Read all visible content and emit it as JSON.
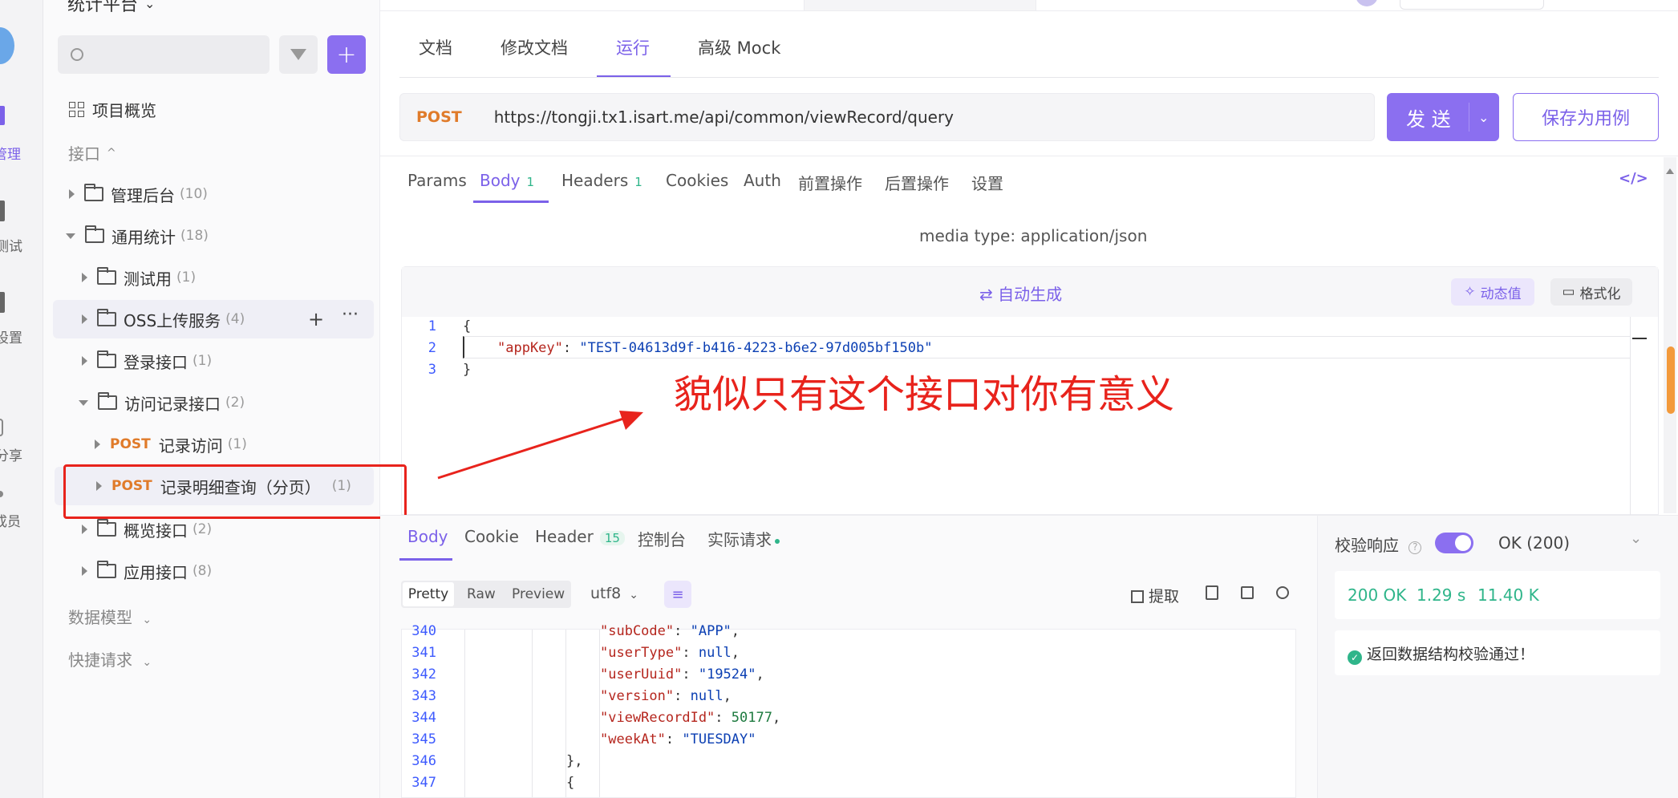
{
  "rail": {
    "items": [
      {
        "label": "管理"
      },
      {
        "label": "测试"
      },
      {
        "label": "设置"
      },
      {
        "label": "分享"
      },
      {
        "label": "成员"
      }
    ]
  },
  "sidebar": {
    "project_title": "统计平台",
    "search_placeholder": "",
    "overview_label": "项目概览",
    "interfaces_label": "接口",
    "tree": [
      {
        "label": "管理后台",
        "count": "(10)",
        "method": ""
      },
      {
        "label": "通用统计",
        "count": "(18)",
        "method": ""
      },
      {
        "label": "测试用",
        "count": "(1)",
        "method": ""
      },
      {
        "label": "OSS上传服务",
        "count": "(4)",
        "method": ""
      },
      {
        "label": "登录接口",
        "count": "(1)",
        "method": ""
      },
      {
        "label": "访问记录接口",
        "count": "(2)",
        "method": ""
      },
      {
        "label": "记录访问",
        "count": "(1)",
        "method": "POST"
      },
      {
        "label": "记录明细查询（分页）",
        "count": "(1)",
        "method": "POST"
      },
      {
        "label": "概览接口",
        "count": "(2)",
        "method": ""
      },
      {
        "label": "应用接口",
        "count": "(8)",
        "method": ""
      }
    ],
    "data_model_label": "数据模型",
    "quick_request_label": "快捷请求"
  },
  "main": {
    "tabs": [
      "文档",
      "修改文档",
      "运行",
      "高级 Mock"
    ],
    "method": "POST",
    "url": "https://tongji.tx1.isart.me/api/common/viewRecord/query",
    "send_label": "发 送",
    "save_label": "保存为用例",
    "req_tabs": [
      {
        "label": "Params",
        "badge": ""
      },
      {
        "label": "Body",
        "badge": "1"
      },
      {
        "label": "Headers",
        "badge": "1"
      },
      {
        "label": "Cookies",
        "badge": ""
      },
      {
        "label": "Auth",
        "badge": ""
      },
      {
        "label": "前置操作",
        "badge": ""
      },
      {
        "label": "后置操作",
        "badge": ""
      },
      {
        "label": "设置",
        "badge": ""
      }
    ],
    "media_type": "media type: application/json",
    "auto_generate": "自动生成",
    "dynamic_value": "动态值",
    "format": "格式化",
    "body_lines": [
      {
        "no": "1",
        "text": "{"
      },
      {
        "no": "2",
        "key": "\"appKey\"",
        "value": "\"TEST-04613d9f-b416-4223-b6e2-97d005bf150b\""
      },
      {
        "no": "3",
        "text": "}"
      }
    ],
    "annotation": "貌似只有这个接口对你有意义"
  },
  "response": {
    "tabs": [
      {
        "label": "Body",
        "badge": ""
      },
      {
        "label": "Cookie",
        "badge": ""
      },
      {
        "label": "Header",
        "badge": "15"
      },
      {
        "label": "控制台",
        "badge": ""
      },
      {
        "label": "实际请求",
        "badge": ""
      }
    ],
    "view_modes": [
      "Pretty",
      "Raw",
      "Preview"
    ],
    "encoding": "utf8",
    "extract_label": "提取",
    "lines": [
      {
        "no": "340",
        "key": "\"subCode\"",
        "value": "\"APP\"",
        "type": "s",
        "indent": 5
      },
      {
        "no": "341",
        "key": "\"userType\"",
        "value": "null",
        "type": "kw",
        "indent": 5
      },
      {
        "no": "342",
        "key": "\"userUuid\"",
        "value": "\"19524\"",
        "type": "s",
        "indent": 5
      },
      {
        "no": "343",
        "key": "\"version\"",
        "value": "null",
        "type": "kw",
        "indent": 5
      },
      {
        "no": "344",
        "key": "\"viewRecordId\"",
        "value": "50177",
        "type": "n",
        "indent": 5
      },
      {
        "no": "345",
        "key": "\"weekAt\"",
        "value": "\"TUESDAY\"",
        "type": "s",
        "indent": 5,
        "last": true
      },
      {
        "no": "346",
        "text": "},",
        "indent": 4
      },
      {
        "no": "347",
        "text": "{",
        "indent": 4
      }
    ],
    "validate_label": "校验响应",
    "validate_status": "OK (200)",
    "status": "200 OK",
    "time": "1.29 s",
    "size": "11.40 K",
    "validate_msg": "返回数据结构校验通过！"
  },
  "colors": {
    "accent": "#7b61e9",
    "post": "#e07b2a",
    "annotation": "#e8231c",
    "ok": "#2fb58a"
  }
}
